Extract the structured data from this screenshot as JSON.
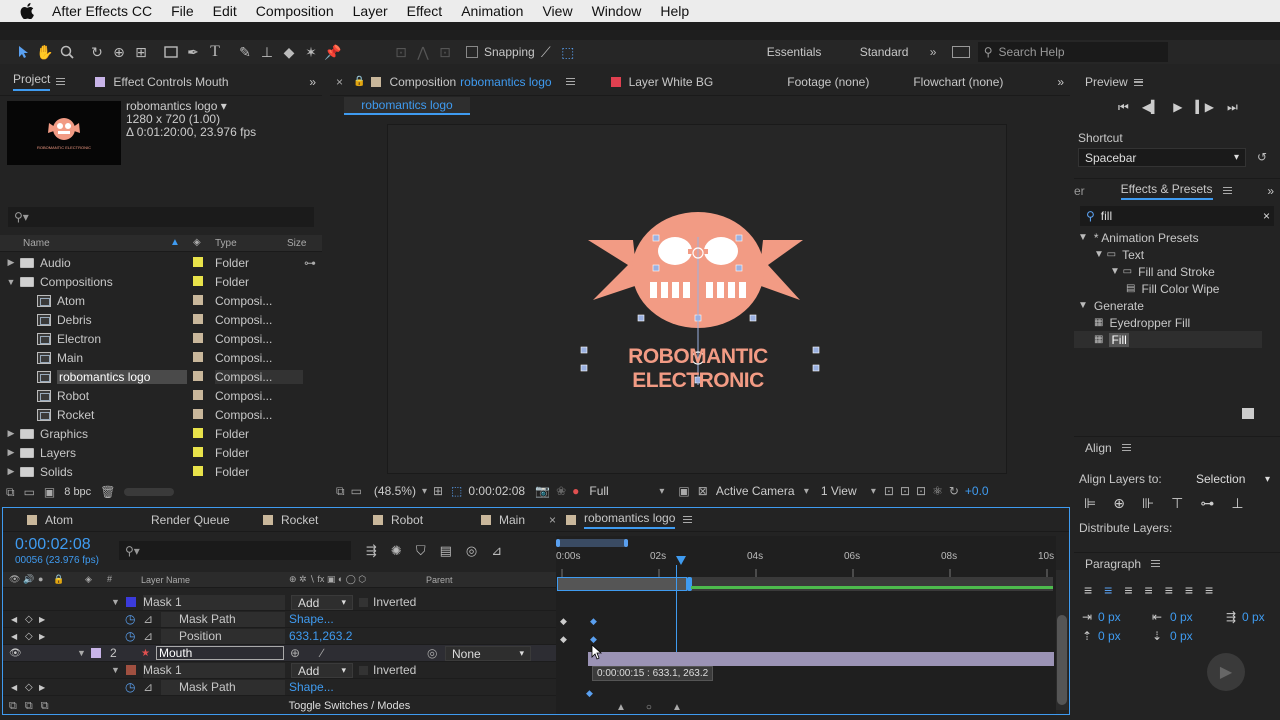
{
  "menubar": {
    "app_name": "After Effects CC",
    "items": [
      "File",
      "Edit",
      "Composition",
      "Layer",
      "Effect",
      "Animation",
      "View",
      "Window",
      "Help"
    ]
  },
  "toolbar": {
    "snapping_label": "Snapping",
    "workspaces": [
      "Essentials",
      "Standard"
    ],
    "search_placeholder": "Search Help"
  },
  "project": {
    "tab_label": "Project",
    "effect_controls_label": "Effect Controls Mouth",
    "comp_name": "robomantics logo ▾",
    "comp_size": "1280 x 720 (1.00)",
    "comp_duration": "Δ 0:01:20:00, 23.976 fps",
    "thumb_caption": "ROBOMANTIC ELECTRONIC",
    "columns": {
      "name": "Name",
      "type": "Type",
      "size": "Size"
    },
    "items": [
      {
        "name": "Audio",
        "type": "Folder",
        "kind": "folder",
        "level": 0,
        "expanded": false,
        "color": "#e8e24a"
      },
      {
        "name": "Compositions",
        "type": "Folder",
        "kind": "folder",
        "level": 0,
        "expanded": true,
        "color": "#e8e24a"
      },
      {
        "name": "Atom",
        "type": "Composi...",
        "kind": "comp",
        "level": 1,
        "color": "#c9b79b"
      },
      {
        "name": "Debris",
        "type": "Composi...",
        "kind": "comp",
        "level": 1,
        "color": "#c9b79b"
      },
      {
        "name": "Electron",
        "type": "Composi...",
        "kind": "comp",
        "level": 1,
        "color": "#c9b79b"
      },
      {
        "name": "Main",
        "type": "Composi...",
        "kind": "comp",
        "level": 1,
        "color": "#c9b79b"
      },
      {
        "name": "robomantics logo",
        "type": "Composi...",
        "kind": "comp",
        "level": 1,
        "color": "#c9b79b",
        "selected": true
      },
      {
        "name": "Robot",
        "type": "Composi...",
        "kind": "comp",
        "level": 1,
        "color": "#c9b79b"
      },
      {
        "name": "Rocket",
        "type": "Composi...",
        "kind": "comp",
        "level": 1,
        "color": "#c9b79b"
      },
      {
        "name": "Graphics",
        "type": "Folder",
        "kind": "folder",
        "level": 0,
        "expanded": false,
        "color": "#e8e24a"
      },
      {
        "name": "Layers",
        "type": "Folder",
        "kind": "folder",
        "level": 0,
        "expanded": false,
        "color": "#e8e24a"
      },
      {
        "name": "Solids",
        "type": "Folder",
        "kind": "folder",
        "level": 0,
        "expanded": false,
        "color": "#e8e24a"
      }
    ],
    "bpc_label": "8 bpc"
  },
  "composition": {
    "tab_prefix": "Composition",
    "tab_name": "robomantics logo",
    "layer_tab": "Layer White BG",
    "footage_tab": "Footage (none)",
    "flowchart_tab": "Flowchart (none)",
    "subtab": "robomantics logo",
    "logo_text": "ROBOMANTIC ELECTRONIC",
    "zoom": "(48.5%)",
    "timecode": "0:00:02:08",
    "resolution": "Full",
    "camera": "Active Camera",
    "view": "1 View",
    "exposure": "+0.0"
  },
  "preview": {
    "title": "Preview",
    "shortcut_label": "Shortcut",
    "shortcut_value": "Spacebar"
  },
  "effects": {
    "left_tab_fragment": "er",
    "title": "Effects & Presets",
    "search_value": "fill",
    "tree": [
      {
        "label": "* Animation Presets",
        "level": 0,
        "kind": "group"
      },
      {
        "label": "Text",
        "level": 1,
        "kind": "folder"
      },
      {
        "label": "Fill and Stroke",
        "level": 2,
        "kind": "folder"
      },
      {
        "label": "Fill Color Wipe",
        "level": 3,
        "kind": "preset"
      },
      {
        "label": "Generate",
        "level": 0,
        "kind": "group"
      },
      {
        "label": "Eyedropper Fill",
        "level": 1,
        "kind": "effect"
      },
      {
        "label": "Fill",
        "level": 1,
        "kind": "effect",
        "selected": true
      }
    ]
  },
  "align": {
    "title": "Align",
    "align_to_label": "Align Layers to:",
    "align_to_value": "Selection",
    "distribute_label": "Distribute Layers:"
  },
  "paragraph": {
    "title": "Paragraph",
    "indent_values": [
      "0 px",
      "0 px",
      "0 px",
      "0 px",
      "0 px"
    ]
  },
  "timeline": {
    "tabs": [
      {
        "label": "Atom",
        "color": "#c9b79b"
      },
      {
        "label": "Render Queue",
        "color": null
      },
      {
        "label": "Rocket",
        "color": "#c9b79b"
      },
      {
        "label": "Robot",
        "color": "#c9b79b"
      },
      {
        "label": "Main",
        "color": "#c9b79b"
      },
      {
        "label": "robomantics logo",
        "color": "#c9b79b",
        "active": true
      }
    ],
    "timecode": "0:00:02:08",
    "frame_info": "00056 (23.976 fps)",
    "col_layer_name": "Layer Name",
    "col_parent": "Parent",
    "ruler_labels": [
      "0:00s",
      "02s",
      "04s",
      "06s",
      "08s",
      "10s"
    ],
    "rows": [
      {
        "kind": "mask",
        "name": "Mask 1",
        "mode": "Add",
        "inverted": "Inverted",
        "color": "#3b3bdb"
      },
      {
        "kind": "prop",
        "name": "Mask Path",
        "value": "Shape..."
      },
      {
        "kind": "prop",
        "name": "Position",
        "value": "633.1,263.2"
      },
      {
        "kind": "layer",
        "index": "2",
        "name": "Mouth",
        "parent": "None"
      },
      {
        "kind": "mask",
        "name": "Mask 1",
        "mode": "Add",
        "inverted": "Inverted",
        "color": "#a05040"
      },
      {
        "kind": "prop",
        "name": "Mask Path",
        "value": "Shape..."
      }
    ],
    "tooltip": "0:00:00:15 : 633.1, 263.2",
    "toggle_label": "Toggle Switches / Modes"
  },
  "colors": {
    "accent": "#3f9bf0",
    "logo": "#f29b84",
    "folder_label": "#e8e24a",
    "comp_label": "#c9b79b",
    "layer_bar": "#9b93b5"
  }
}
